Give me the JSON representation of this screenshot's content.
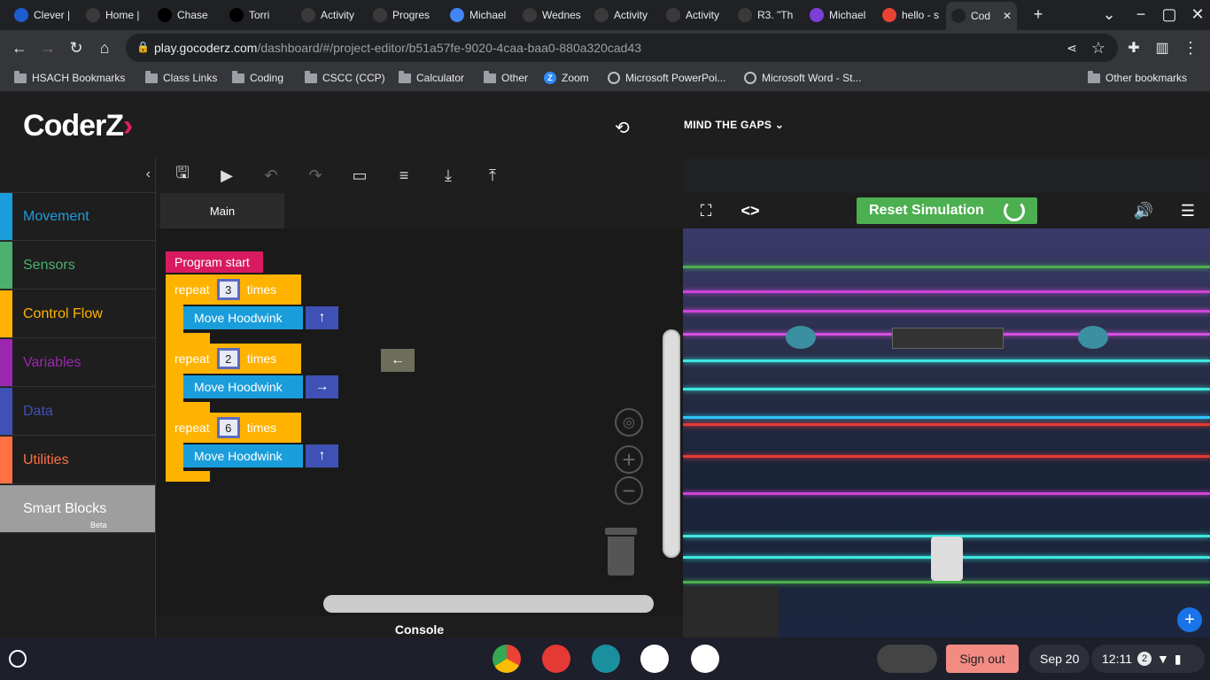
{
  "browser": {
    "tabs": [
      {
        "label": "Clever |",
        "icon": "clever-icon",
        "color": "#1e5cd0"
      },
      {
        "label": "Home |",
        "icon": "schoology-icon",
        "color": "#3a3a3a"
      },
      {
        "label": "Chase",
        "icon": "blackboard-icon",
        "color": "#000000"
      },
      {
        "label": "Torri",
        "icon": "blackboard-icon",
        "color": "#000000"
      },
      {
        "label": "Activity",
        "icon": "schoology-icon",
        "color": "#3a3a3a"
      },
      {
        "label": "Progres",
        "icon": "schoology-icon",
        "color": "#3a3a3a"
      },
      {
        "label": "Michael",
        "icon": "docs-icon",
        "color": "#4285f4"
      },
      {
        "label": "Wednes",
        "icon": "schoology-icon",
        "color": "#3a3a3a"
      },
      {
        "label": "Activity",
        "icon": "schoology-icon",
        "color": "#3a3a3a"
      },
      {
        "label": "Activity",
        "icon": "schoology-icon",
        "color": "#3a3a3a"
      },
      {
        "label": "R3. \"Th",
        "icon": "schoology-icon",
        "color": "#3a3a3a"
      },
      {
        "label": "Michael",
        "icon": "kami-icon",
        "color": "#7e3fd8"
      },
      {
        "label": "hello - s",
        "icon": "gmail-icon",
        "color": "#ea4335"
      },
      {
        "label": "Cod",
        "icon": "coderz-icon",
        "color": "#202124"
      }
    ],
    "url_host": "play.gocoderz.com",
    "url_path": "/dashboard/#/project-editor/b51a57fe-9020-4caa-baa0-880a320cad43",
    "bookmarks": [
      {
        "label": "HSACH Bookmarks",
        "type": "folder"
      },
      {
        "label": "Class Links",
        "type": "folder"
      },
      {
        "label": "Coding",
        "type": "folder"
      },
      {
        "label": "CSCC (CCP)",
        "type": "folder"
      },
      {
        "label": "Calculator",
        "type": "folder"
      },
      {
        "label": "Other",
        "type": "folder"
      },
      {
        "label": "Zoom",
        "type": "zoom"
      },
      {
        "label": "Microsoft PowerPoi...",
        "type": "web"
      },
      {
        "label": "Microsoft Word - St...",
        "type": "web"
      }
    ],
    "other_bookmarks": "Other bookmarks"
  },
  "app": {
    "logo_main": "C",
    "logo_o": "o",
    "logo_rest": "derZ",
    "mission": "MIND THE GAPS"
  },
  "categories": [
    {
      "label": "Movement",
      "color": "#1a9ddb"
    },
    {
      "label": "Sensors",
      "color": "#4caf6e"
    },
    {
      "label": "Control Flow",
      "color": "#ffb300"
    },
    {
      "label": "Variables",
      "color": "#9c27b0"
    },
    {
      "label": "Data",
      "color": "#3f51b5"
    },
    {
      "label": "Utilities",
      "color": "#ff7043"
    },
    {
      "label": "Smart Blocks",
      "color": "#9e9e9e",
      "badge": "Beta"
    }
  ],
  "workspace": {
    "tab": "Main",
    "start": "Program start",
    "repeat_word": "repeat",
    "times_word": "times",
    "loops": [
      {
        "count": "3",
        "action": "Move Hoodwink",
        "direction": "↑"
      },
      {
        "count": "2",
        "action": "Move Hoodwink",
        "direction": "→"
      },
      {
        "count": "6",
        "action": "Move Hoodwink",
        "direction": "↑"
      }
    ],
    "loose_block": "←",
    "console": "Console"
  },
  "sim": {
    "reset_label": "Reset Simulation"
  },
  "shelf": {
    "signout": "Sign out",
    "date": "Sep 20",
    "time": "12:11",
    "notif_count": "2"
  }
}
